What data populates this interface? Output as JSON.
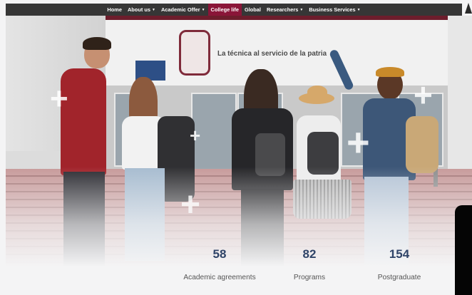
{
  "nav": {
    "items": [
      {
        "label": "Home",
        "dropdown": false,
        "active": false
      },
      {
        "label": "About us",
        "dropdown": true,
        "active": false
      },
      {
        "label": "Academic Offer",
        "dropdown": true,
        "active": false
      },
      {
        "label": "College life",
        "dropdown": false,
        "active": true
      },
      {
        "label": "Global",
        "dropdown": false,
        "active": false
      },
      {
        "label": "Researchers",
        "dropdown": true,
        "active": false
      },
      {
        "label": "Business Services",
        "dropdown": true,
        "active": false
      }
    ],
    "active_color": "#8a1538",
    "bar_color": "#363636"
  },
  "hero": {
    "building_sign": "La técnica al servicio de la patria",
    "emblem_icon": "institution-emblem-icon"
  },
  "stats": [
    {
      "value": "58",
      "label": "Academic agreements"
    },
    {
      "value": "82",
      "label": "Programs"
    },
    {
      "value": "154",
      "label": "Postgraduate"
    }
  ],
  "colors": {
    "stat_value": "#2f4468",
    "accent": "#8a1538"
  }
}
